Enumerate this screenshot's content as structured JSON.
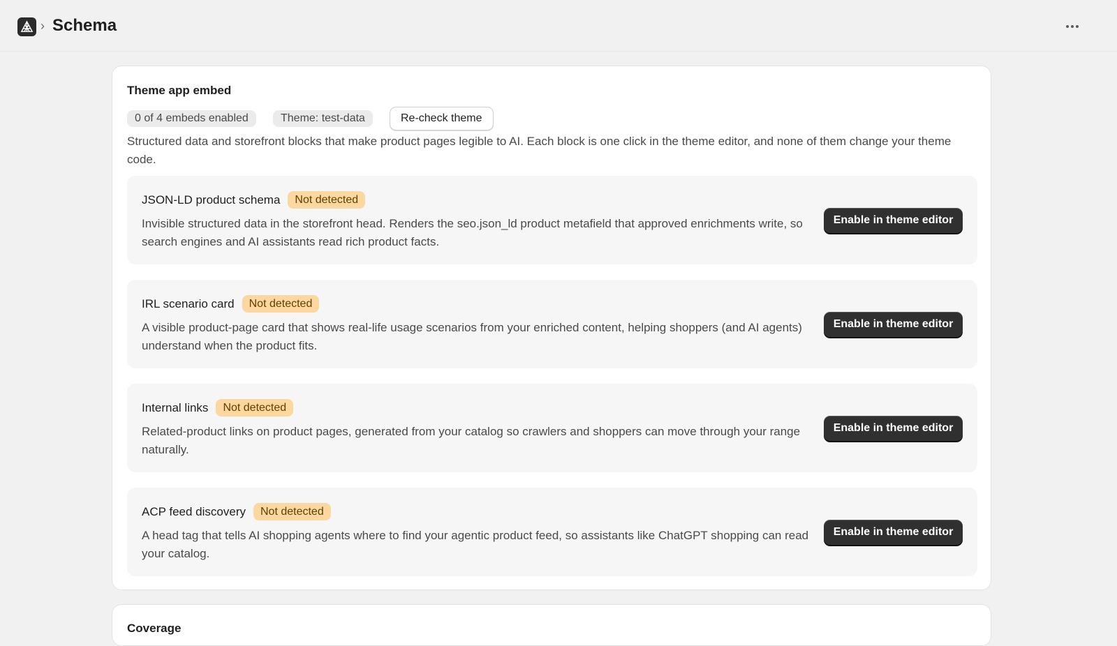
{
  "header": {
    "app_icon": "app-logo-icon",
    "breadcrumb_separator": "›",
    "title": "Schema",
    "more_icon": "more-horizontal-icon"
  },
  "theme_embed": {
    "title": "Theme app embed",
    "embeds_status": "0 of 4 embeds enabled",
    "theme_label": "Theme: test-data",
    "recheck_label": "Re-check theme",
    "description": "Structured data and storefront blocks that make product pages legible to AI. Each block is one click in the theme editor, and none of them change your theme code.",
    "blocks": [
      {
        "title": "JSON-LD product schema",
        "status": "Not detected",
        "description": "Invisible structured data in the storefront head. Renders the seo.json_ld product metafield that approved enrichments write, so search engines and AI assistants read rich product facts.",
        "button": "Enable in theme editor"
      },
      {
        "title": "IRL scenario card",
        "status": "Not detected",
        "description": "A visible product-page card that shows real-life usage scenarios from your enriched content, helping shoppers (and AI agents) understand when the product fits.",
        "button": "Enable in theme editor"
      },
      {
        "title": "Internal links",
        "status": "Not detected",
        "description": "Related-product links on product pages, generated from your catalog so crawlers and shoppers can move through your range naturally.",
        "button": "Enable in theme editor"
      },
      {
        "title": "ACP feed discovery",
        "status": "Not detected",
        "description": "A head tag that tells AI shopping agents where to find your agentic product feed, so assistants like ChatGPT shopping can read your catalog.",
        "button": "Enable in theme editor"
      }
    ]
  },
  "coverage": {
    "title": "Coverage"
  },
  "colors": {
    "background": "#f1f1f1",
    "card": "#ffffff",
    "badge_warning": "#fcd79f",
    "primary_button": "#303030"
  }
}
